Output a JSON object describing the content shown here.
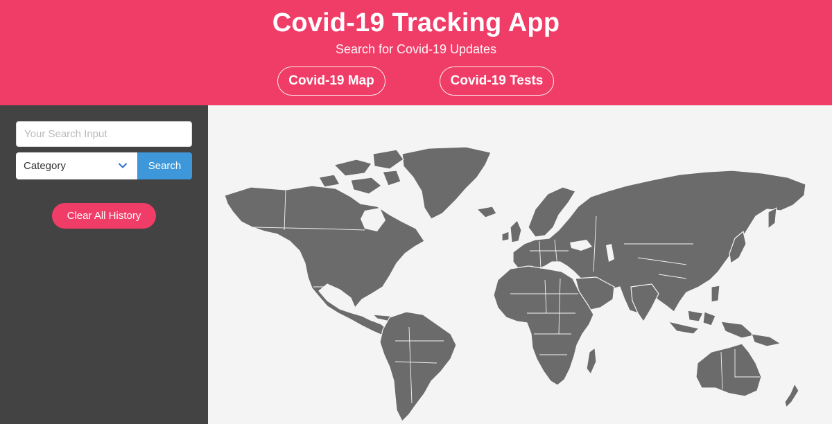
{
  "header": {
    "title": "Covid-19 Tracking App",
    "subtitle": "Search for Covid-19 Updates",
    "nav": [
      {
        "label": "Covid-19 Map"
      },
      {
        "label": "Covid-19 Tests"
      }
    ],
    "background_color": "#f03d68"
  },
  "sidebar": {
    "search_placeholder": "Your Search Input",
    "category_label": "Category",
    "search_button": "Search",
    "clear_button": "Clear All History",
    "background_color": "#434343",
    "search_button_color": "#3d97d9"
  },
  "map": {
    "land_color": "#6b6b6b",
    "background_color": "#f4f4f4",
    "icon": "world-map"
  }
}
